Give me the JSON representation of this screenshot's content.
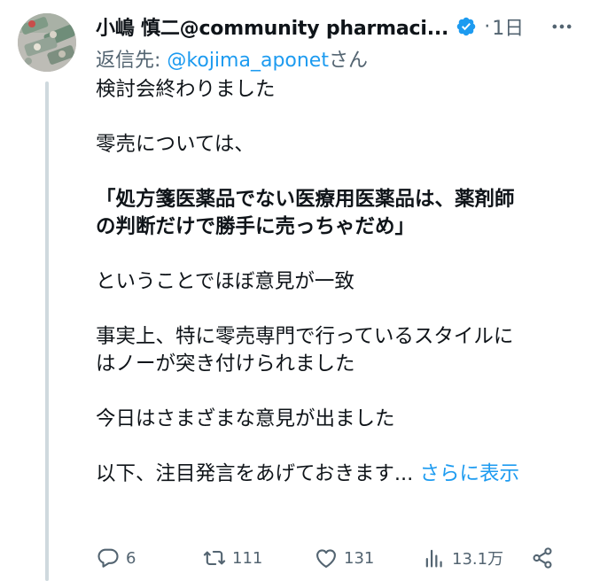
{
  "author": {
    "display_name": "小嶋 慎二@community pharmaci...",
    "time": "1日"
  },
  "reply_to": {
    "prefix": "返信先: ",
    "handle": "@kojima_aponet",
    "suffix": "さん"
  },
  "tweet": {
    "lines": [
      "検討会終わりました",
      "",
      "零売については、",
      "",
      "「処方箋医薬品でない医療用医薬品は、薬剤師",
      "の判断だけで勝手に売っちゃだめ」",
      "",
      "ということでほぼ意見が一致",
      "",
      "事実上、特に零売専門で行っているスタイルに",
      "はノーが突き付けられました",
      "",
      "今日はさまざまな意見が出ました",
      ""
    ],
    "last_line": "以下、注目発言をあげておきます...",
    "show_more": "さらに表示"
  },
  "actions": {
    "reply_count": "6",
    "retweet_count": "111",
    "like_count": "131",
    "view_count": "13.1万"
  },
  "icons": {
    "verified": "verified-badge-icon",
    "more": "more-icon",
    "reply": "reply-icon",
    "retweet": "retweet-icon",
    "like": "heart-icon",
    "views": "views-chart-icon",
    "share": "share-icon"
  },
  "colors": {
    "accent": "#1d9bf0",
    "secondary_text": "#536471",
    "text": "#0f1419",
    "thread_line": "#cfd9de"
  }
}
